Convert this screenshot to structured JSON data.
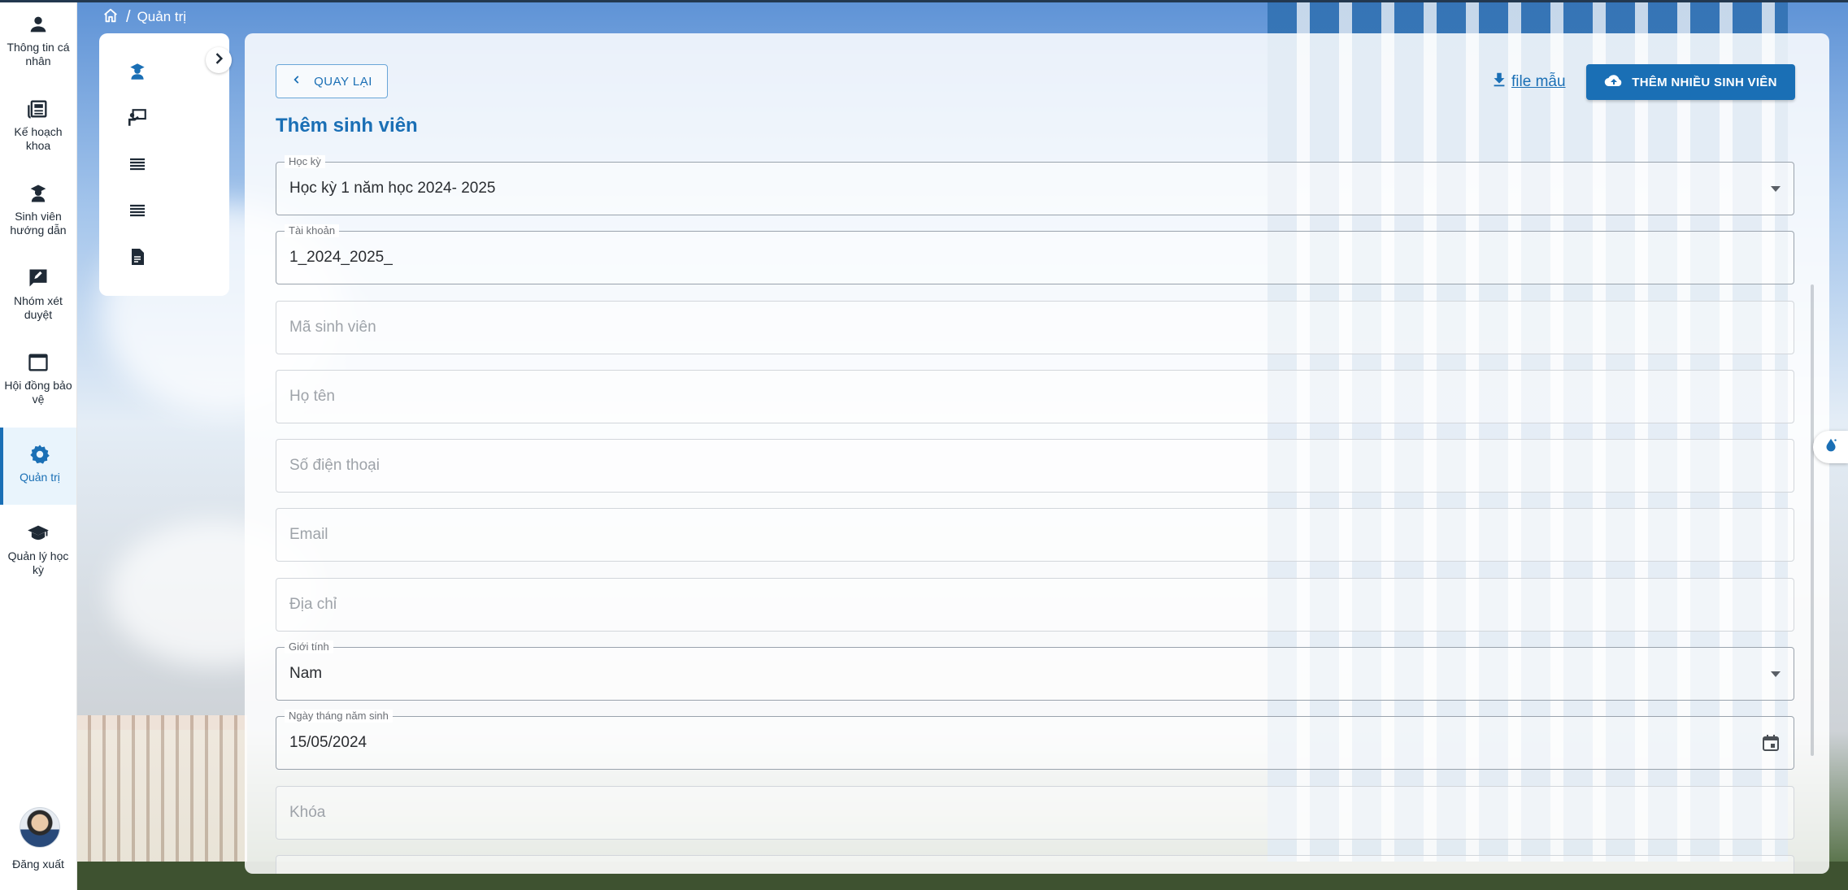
{
  "breadcrumb": {
    "current": "Quản trị",
    "separator": "/"
  },
  "rail": {
    "items": [
      {
        "label": "Thông tin cá nhân",
        "icon": "person-icon"
      },
      {
        "label": "Kế hoạch khoa",
        "icon": "newspaper-icon"
      },
      {
        "label": "Sinh viên hướng dẫn",
        "icon": "student-icon"
      },
      {
        "label": "Nhóm xét duyệt",
        "icon": "rate-review-icon"
      },
      {
        "label": "Hội đồng bảo vệ",
        "icon": "window-icon"
      },
      {
        "label": "Quản trị",
        "icon": "gear-icon",
        "active": true
      },
      {
        "label": "Quản lý học kỳ",
        "icon": "graduation-cap-icon"
      }
    ],
    "logout_label": "Đăng xuất"
  },
  "form": {
    "back_label": "QUAY LẠI",
    "file_link": "file mẫu",
    "add_many_label": "THÊM NHIỀU SINH VIÊN",
    "title": "Thêm sinh viên",
    "fields": {
      "semester": {
        "label": "Học kỳ",
        "value": "Học kỳ 1 năm học 2024- 2025"
      },
      "account": {
        "label": "Tài khoản",
        "value": "1_2024_2025_"
      },
      "student_id": {
        "placeholder": "Mã sinh viên"
      },
      "full_name": {
        "placeholder": "Họ tên"
      },
      "phone": {
        "placeholder": "Số điện thoại"
      },
      "email": {
        "placeholder": "Email"
      },
      "address": {
        "placeholder": "Địa chỉ"
      },
      "gender": {
        "label": "Giới tính",
        "value": "Nam"
      },
      "dob": {
        "label": "Ngày tháng năm sinh",
        "value": "15/05/2024"
      },
      "course": {
        "placeholder": "Khóa"
      }
    }
  },
  "colors": {
    "accent": "#1a6fb5",
    "rail_bg": "#ffffff"
  }
}
